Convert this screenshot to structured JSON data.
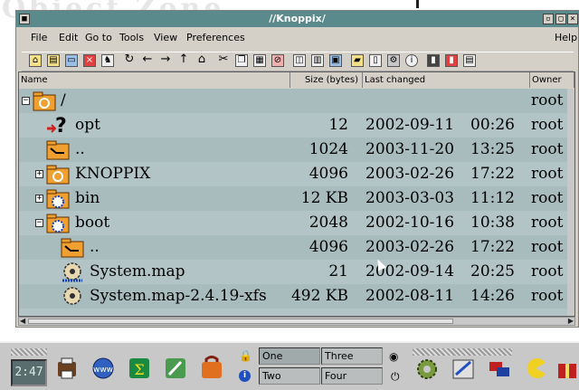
{
  "desktop": {
    "text": "Object Zone"
  },
  "window": {
    "title": "//Knoppix/",
    "buttons": {
      "menu": "■",
      "minimize": "▫",
      "maximize": "▢",
      "close": "×"
    }
  },
  "menubar": {
    "items": [
      "File",
      "Edit",
      "Go to",
      "Tools",
      "View",
      "Preferences"
    ],
    "help": "Help"
  },
  "columns": {
    "name": "Name",
    "size": "Size (bytes)",
    "changed": "Last changed",
    "owner": "Owner"
  },
  "rows": [
    {
      "name": "/",
      "size": "",
      "date": "",
      "time": "",
      "owner": "root",
      "expander": "−",
      "icon": "folder-open-icon"
    },
    {
      "name": "opt",
      "size": "12",
      "date": "2002-09-11",
      "time": "00:26",
      "owner": "root",
      "expander": "",
      "icon": "broken-link-icon"
    },
    {
      "name": "..",
      "size": "1024",
      "date": "2003-11-20",
      "time": "13:25",
      "owner": "root",
      "expander": "",
      "icon": "parent-folder-icon"
    },
    {
      "name": "KNOPPIX",
      "size": "4096",
      "date": "2003-02-26",
      "time": "17:22",
      "owner": "root",
      "expander": "+",
      "icon": "folder-icon"
    },
    {
      "name": "bin",
      "size": "12 KB",
      "date": "2003-03-03",
      "time": "11:12",
      "owner": "root",
      "expander": "+",
      "icon": "folder-gear-icon"
    },
    {
      "name": "boot",
      "size": "2048",
      "date": "2002-10-16",
      "time": "10:38",
      "owner": "root",
      "expander": "−",
      "icon": "folder-gear-icon"
    },
    {
      "name": "..",
      "size": "4096",
      "date": "2003-02-26",
      "time": "17:22",
      "owner": "root",
      "expander": "",
      "icon": "parent-folder-icon"
    },
    {
      "name": "System.map",
      "size": "21",
      "date": "2002-09-14",
      "time": "20:25",
      "owner": "root",
      "expander": "",
      "icon": "gear-file-icon"
    },
    {
      "name": "System.map-2.4.19-xfs",
      "size": "492 KB",
      "date": "2002-08-11",
      "time": "14:26",
      "owner": "root",
      "expander": "",
      "icon": "gear-file-icon"
    }
  ],
  "taskbar": {
    "clock": "2:47",
    "pager": [
      "One",
      "Three",
      "Two",
      "Four"
    ]
  },
  "colors": {
    "title_bar": "#5a8a8c",
    "list_bg": "#b3c4c6",
    "folder": "#f0a030"
  }
}
